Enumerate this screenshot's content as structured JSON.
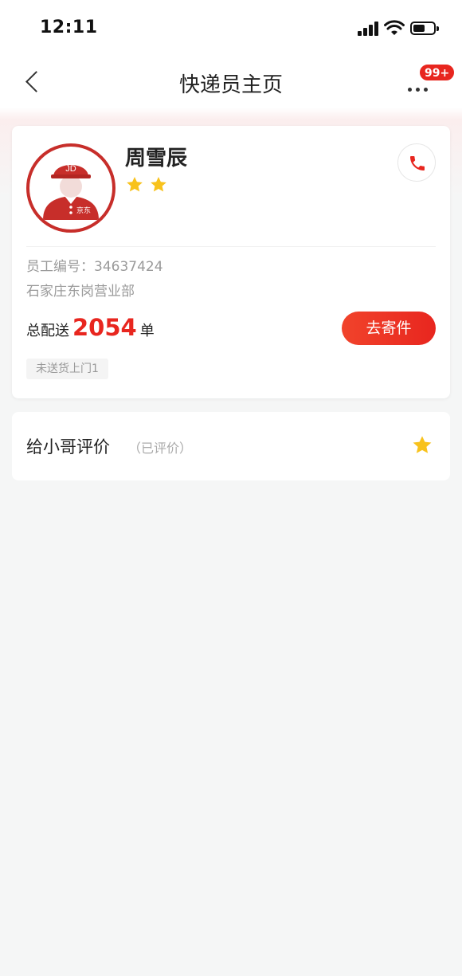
{
  "status_bar": {
    "time": "12:11"
  },
  "nav": {
    "title": "快递员主页",
    "badge": "99+"
  },
  "courier": {
    "name": "周雪辰",
    "star_count": 2,
    "employee_id": "员工编号：34637424",
    "station": "石家庄东岗营业部",
    "total_prefix": "总配送",
    "total_number": "2054",
    "total_suffix": "单",
    "send_button": "去寄件",
    "tag": "未送货上门1",
    "avatar_logo": "JD",
    "avatar_badge": "京东"
  },
  "rating": {
    "title": "给小哥评价",
    "status": "（已评价）"
  },
  "colors": {
    "accent": "#e8261f",
    "star": "#f8c21c",
    "avatar_red": "#c72e2a"
  },
  "icons": [
    "back-arrow-icon",
    "more-icon",
    "phone-icon",
    "star-icon",
    "courier-avatar"
  ]
}
